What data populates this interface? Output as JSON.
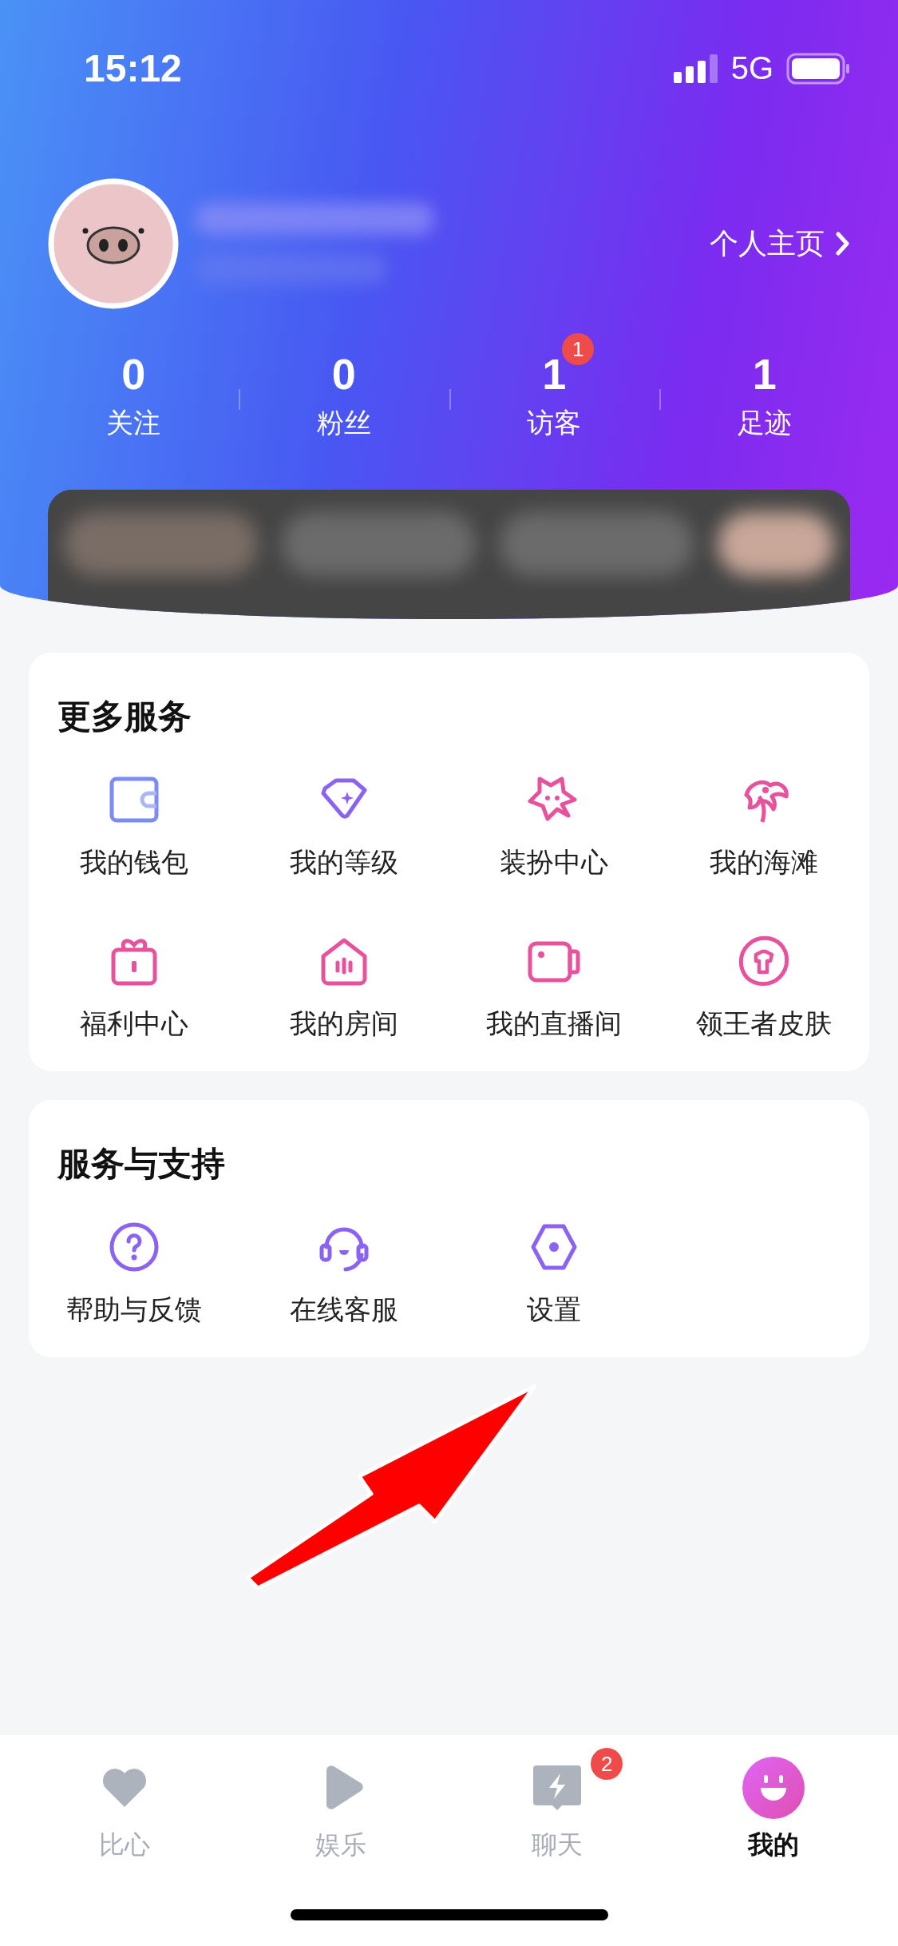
{
  "status_bar": {
    "time": "15:12",
    "network": "5G"
  },
  "profile": {
    "link": "个人主页"
  },
  "stats": [
    {
      "value": "0",
      "label": "关注"
    },
    {
      "value": "0",
      "label": "粉丝"
    },
    {
      "value": "1",
      "label": "访客",
      "badge": "1"
    },
    {
      "value": "1",
      "label": "足迹"
    }
  ],
  "sections": [
    {
      "title": "更多服务",
      "items": [
        {
          "label": "我的钱包",
          "kind": "wallet"
        },
        {
          "label": "我的等级",
          "kind": "level"
        },
        {
          "label": "装扮中心",
          "kind": "star"
        },
        {
          "label": "我的海滩",
          "kind": "palm"
        },
        {
          "label": "福利中心",
          "kind": "gift"
        },
        {
          "label": "我的房间",
          "kind": "room"
        },
        {
          "label": "我的直播间",
          "kind": "camera"
        },
        {
          "label": "领王者皮肤",
          "kind": "skin"
        }
      ]
    },
    {
      "title": "服务与支持",
      "items": [
        {
          "label": "帮助与反馈",
          "kind": "help"
        },
        {
          "label": "在线客服",
          "kind": "headset"
        },
        {
          "label": "设置",
          "kind": "settings"
        }
      ]
    }
  ],
  "tabs": [
    {
      "label": "比心",
      "kind": "heart",
      "selected": false
    },
    {
      "label": "娱乐",
      "kind": "play",
      "selected": false
    },
    {
      "label": "聊天",
      "kind": "chat",
      "selected": false,
      "badge": "2"
    },
    {
      "label": "我的",
      "kind": "smile",
      "selected": true
    }
  ]
}
